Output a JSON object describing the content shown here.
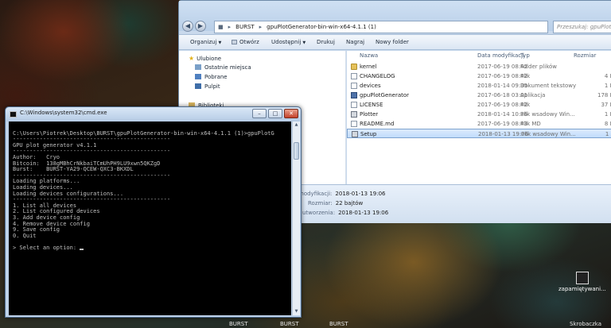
{
  "explorer": {
    "address_segments": [
      "BURST",
      "gpuPlotGenerator-bin-win-x64-4.1.1 (1)"
    ],
    "search_placeholder": "Przeszukaj: gpuPlotG",
    "toolbar": {
      "organize": "Organizuj",
      "open": "Otwórz",
      "share": "Udostępnij",
      "print": "Drukuj",
      "burn": "Nagraj",
      "new_folder": "Nowy folder"
    },
    "nav": {
      "favorites": "Ulubione",
      "recent": "Ostatnie miejsca",
      "downloads": "Pobrane",
      "desktop": "Pulpit",
      "libraries": "Biblioteki"
    },
    "columns": {
      "name": "Nazwa",
      "date": "Data modyfikacji",
      "type": "Typ",
      "size": "Rozmiar"
    },
    "files": [
      {
        "name": "kernel",
        "date": "2017-06-19 08:42",
        "type": "Folder plików",
        "size": "",
        "icon": "folder"
      },
      {
        "name": "CHANGELOG",
        "date": "2017-06-19 08:42",
        "type": "Plik",
        "size": "4 KB",
        "icon": "doc"
      },
      {
        "name": "devices",
        "date": "2018-01-14 09:35",
        "type": "Dokument tekstowy",
        "size": "1 KB",
        "icon": "doc"
      },
      {
        "name": "gpuPlotGenerator",
        "date": "2017-06-18 03:01",
        "type": "Aplikacja",
        "size": "178 KB",
        "icon": "app"
      },
      {
        "name": "LICENSE",
        "date": "2017-06-19 08:42",
        "type": "Plik",
        "size": "37 KB",
        "icon": "doc"
      },
      {
        "name": "Plotter",
        "date": "2018-01-14 10:36",
        "type": "Plik wsadowy Win...",
        "size": "1 KB",
        "icon": "bat"
      },
      {
        "name": "README.md",
        "date": "2017-06-19 08:43",
        "type": "Plik MD",
        "size": "8 KB",
        "icon": "doc"
      },
      {
        "name": "Setup",
        "date": "2018-01-13 19:06",
        "type": "Plik wsadowy Win...",
        "size": "1 KB",
        "icon": "bat"
      }
    ],
    "details": {
      "modified_label": "modyfikacji:",
      "modified_value": "2018-01-13 19:06",
      "size_label": "Rozmiar:",
      "size_value": "22 bajtów",
      "created_label": "utworzenia:",
      "created_value": "2018-01-13 19:06"
    }
  },
  "cmd": {
    "title": "C:\\Windows\\system32\\cmd.exe",
    "lines": [
      "",
      "C:\\Users\\Piotrek\\Desktop\\BURST\\gpuPlotGenerator-bin-win-x64-4.1.1 (1)>gpuPlotG",
      "-----------------------------------------------",
      "GPU plot generator v4.1.1",
      "-----------------------------------------------",
      "Author:   Cryo",
      "Bitcoin:  138gMBhCrNkbaiTCmUhPH9LU9xwn5QKZgD",
      "Burst:    BURST-YA29-QCEW-QXC3-BKXDL",
      "-----------------------------------------------",
      "Loading platforms...",
      "Loading devices...",
      "Loading devices configurations...",
      "-----------------------------------------------",
      "1. List all devices",
      "2. List configured devices",
      "3. Add device config",
      "4. Remove device config",
      "9. Save config",
      "0. Quit",
      "",
      "> Select an option: "
    ]
  },
  "desktop": {
    "icon_label": "zapamiętywani...",
    "taskbar_items": [
      "BURST",
      "BURST",
      "BURST",
      "Skrobaczka"
    ]
  }
}
